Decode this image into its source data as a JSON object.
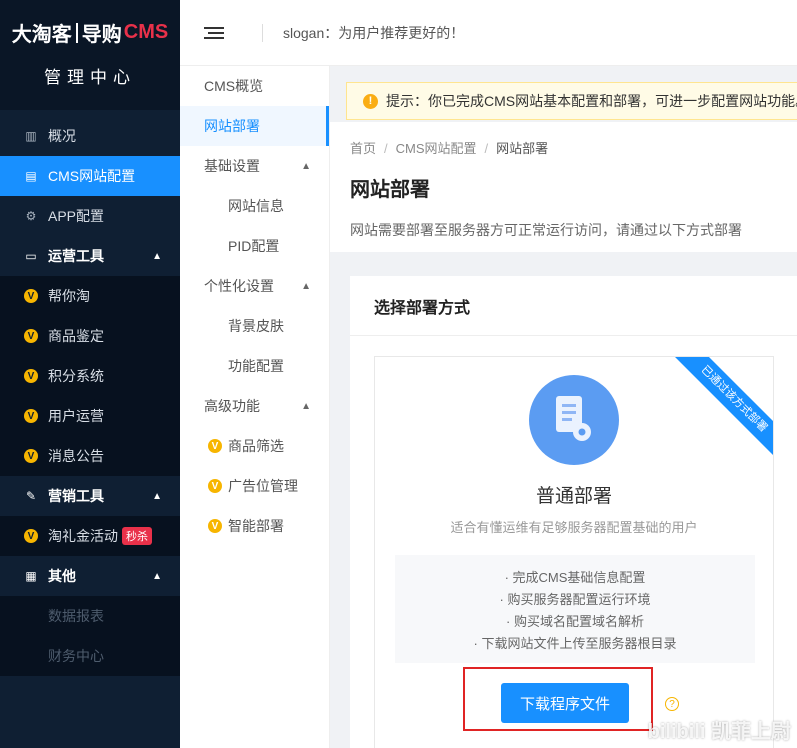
{
  "brand": {
    "logo_part1": "大淘客",
    "logo_part2": "导购",
    "logo_part3": "CMS",
    "subtitle": "管理中心"
  },
  "sidebar": {
    "items": [
      {
        "label": "概况",
        "icon": "chart-icon"
      },
      {
        "label": "CMS网站配置",
        "icon": "document-icon",
        "active": true
      },
      {
        "label": "APP配置",
        "icon": "gear-icon"
      },
      {
        "label": "运营工具",
        "icon": "monitor-icon",
        "group": true
      },
      {
        "label": "帮你淘",
        "icon": "v-badge-icon"
      },
      {
        "label": "商品鉴定",
        "icon": "v-badge-icon"
      },
      {
        "label": "积分系统",
        "icon": "v-badge-icon"
      },
      {
        "label": "用户运营",
        "icon": "v-badge-icon"
      },
      {
        "label": "消息公告",
        "icon": "v-badge-icon"
      },
      {
        "label": "营销工具",
        "icon": "wrench-icon",
        "group": true
      },
      {
        "label": "淘礼金活动",
        "icon": "v-badge-icon",
        "tag": "秒杀"
      },
      {
        "label": "其他",
        "icon": "grid-icon",
        "group": true
      },
      {
        "label": "数据报表"
      },
      {
        "label": "财务中心"
      }
    ]
  },
  "header": {
    "slogan": "slogan：为用户推荐更好的！"
  },
  "subnav": {
    "items": [
      {
        "label": "CMS概览"
      },
      {
        "label": "网站部署",
        "active": true
      },
      {
        "label": "基础设置"
      },
      {
        "label": "网站信息"
      },
      {
        "label": "PID配置"
      },
      {
        "label": "个性化设置"
      },
      {
        "label": "背景皮肤"
      },
      {
        "label": "功能配置"
      },
      {
        "label": "高级功能"
      },
      {
        "label": "商品筛选"
      },
      {
        "label": "广告位管理"
      },
      {
        "label": "智能部署"
      }
    ]
  },
  "notice": {
    "text": "提示：你已完成CMS网站基本配置和部署，可进一步配置网站功能。"
  },
  "breadcrumb": [
    "首页",
    "CMS网站配置",
    "网站部署"
  ],
  "page": {
    "title": "网站部署",
    "description": "网站需要部署至服务器方可正常运行访问，请通过以下方式部署"
  },
  "card": {
    "title": "选择部署方式",
    "option": {
      "ribbon": "已通过该方式部署",
      "title": "普通部署",
      "subtitle": "适合有懂运维有足够服务器配置基础的用户",
      "steps": [
        "· 完成CMS基础信息配置",
        "· 购买服务器配置运行环境",
        "· 购买域名配置域名解析",
        "· 下载网站文件上传至服务器根目录"
      ],
      "button": "下载程序文件"
    }
  },
  "watermark": "bilibili 凯菲上尉",
  "colors": {
    "sidebar_bg": "#0f1f33",
    "accent": "#1890ff",
    "logo_red": "#e9314a",
    "badge_yellow": "#f7b500",
    "highlight_border": "#e02424"
  }
}
